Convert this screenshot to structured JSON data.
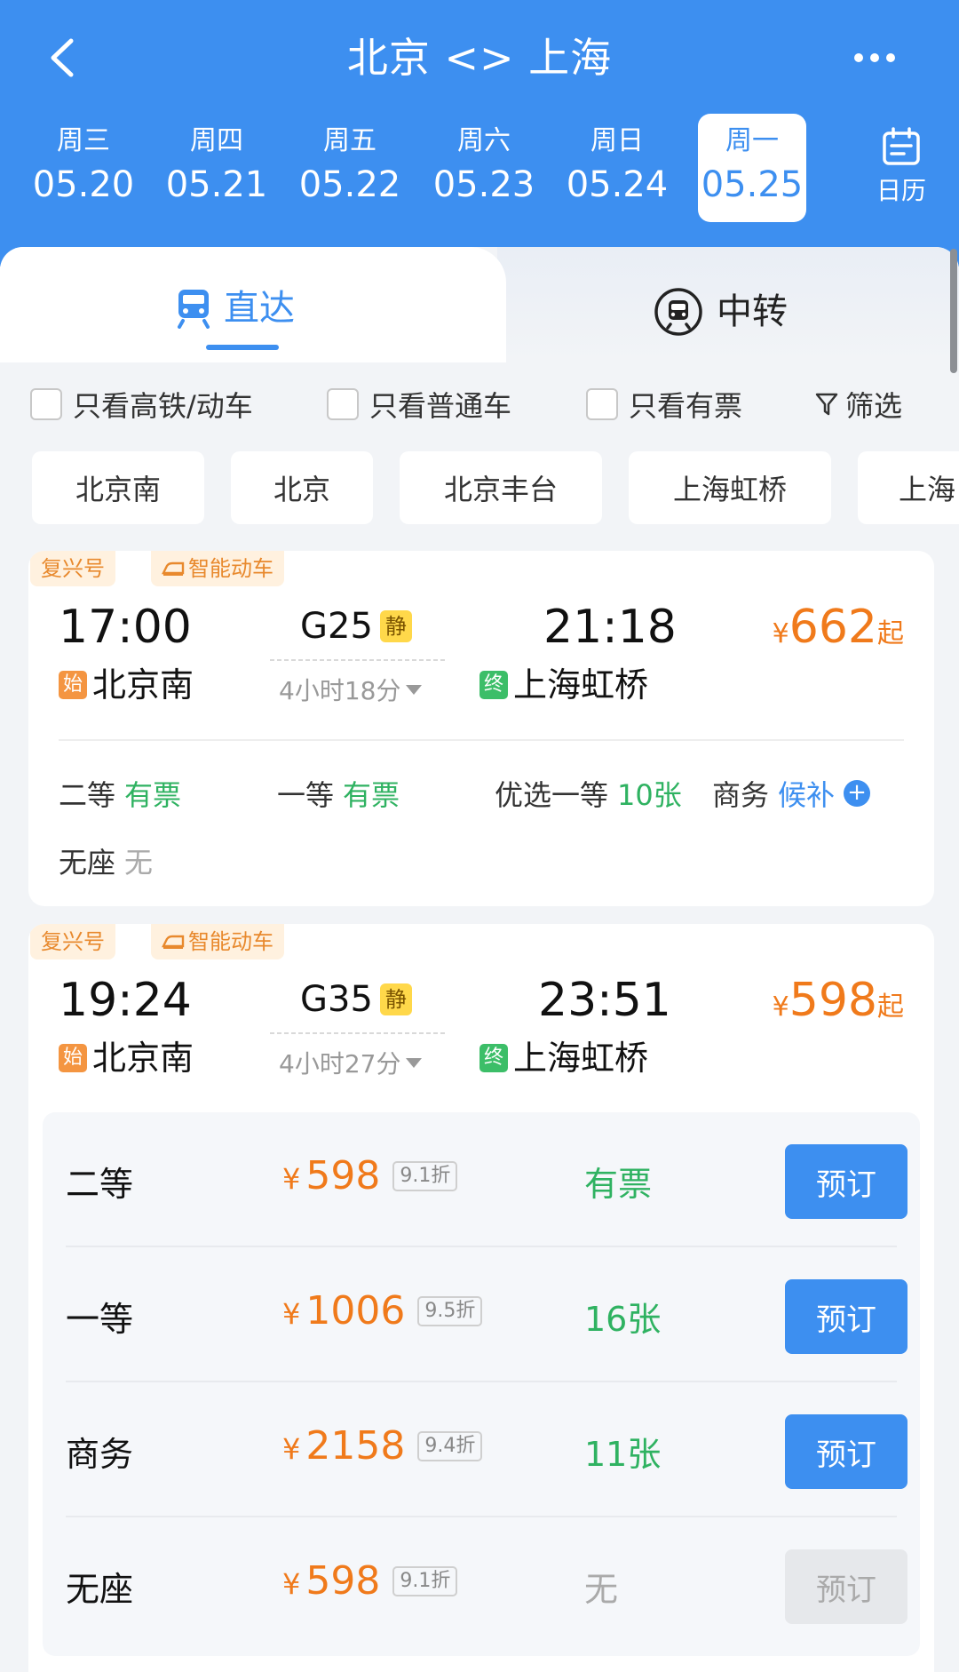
{
  "header": {
    "title": "北京 <> 上海"
  },
  "dates": [
    {
      "weekday": "周三",
      "date": "05.20"
    },
    {
      "weekday": "周四",
      "date": "05.21"
    },
    {
      "weekday": "周五",
      "date": "05.22"
    },
    {
      "weekday": "周六",
      "date": "05.23"
    },
    {
      "weekday": "周日",
      "date": "05.24"
    },
    {
      "weekday": "周一",
      "date": "05.25"
    }
  ],
  "calendar_label": "日历",
  "tabs": {
    "direct": "直达",
    "transfer": "中转"
  },
  "filters": {
    "high_speed": "只看高铁/动车",
    "normal": "只看普通车",
    "available": "只看有票",
    "filter_btn": "筛选"
  },
  "stations": [
    "北京南",
    "北京",
    "北京丰台",
    "上海虹桥",
    "上海"
  ],
  "trains": [
    {
      "badge1": "复兴号",
      "badge2": "智能动车",
      "depart_time": "17:00",
      "arrive_time": "21:18",
      "train_no": "G25",
      "quiet": "静",
      "duration": "4小时18分",
      "start_tag": "始",
      "from": "北京南",
      "end_tag": "终",
      "to": "上海虹桥",
      "price_yen": "¥",
      "price": "662",
      "price_suffix": "起",
      "seats": {
        "second": "二等",
        "second_status": "有票",
        "first": "一等",
        "first_status": "有票",
        "premium_first": "优选一等",
        "premium_first_status": "10张",
        "business": "商务",
        "business_status": "候补",
        "standing": "无座",
        "standing_status": "无"
      }
    },
    {
      "badge1": "复兴号",
      "badge2": "智能动车",
      "depart_time": "19:24",
      "arrive_time": "23:51",
      "train_no": "G35",
      "quiet": "静",
      "duration": "4小时27分",
      "start_tag": "始",
      "from": "北京南",
      "end_tag": "终",
      "to": "上海虹桥",
      "price_yen": "¥",
      "price": "598",
      "price_suffix": "起",
      "seat_rows": [
        {
          "name": "二等",
          "yen": "¥",
          "price": "598",
          "discount": "9.1折",
          "avail": "有票",
          "book": "预订"
        },
        {
          "name": "一等",
          "yen": "¥",
          "price": "1006",
          "discount": "9.5折",
          "avail": "16张",
          "book": "预订"
        },
        {
          "name": "商务",
          "yen": "¥",
          "price": "2158",
          "discount": "9.4折",
          "avail": "11张",
          "book": "预订"
        },
        {
          "name": "无座",
          "yen": "¥",
          "price": "598",
          "discount": "9.1折",
          "avail": "无",
          "book": "预订"
        }
      ]
    }
  ]
}
